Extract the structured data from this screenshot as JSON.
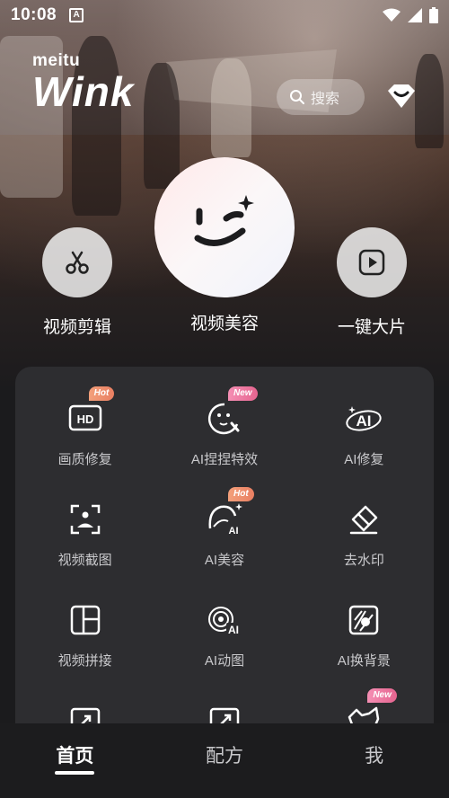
{
  "status_bar": {
    "time": "10:08",
    "notification_glyph": "A",
    "icons": [
      "wifi-icon",
      "cell-signal-icon",
      "battery-icon"
    ]
  },
  "header": {
    "brand": "meitu",
    "app_name": "Wink",
    "search_placeholder": "搜索",
    "vip_icon": "vip-diamond-icon"
  },
  "main_actions": [
    {
      "label": "视频剪辑",
      "icon": "scissors-icon"
    },
    {
      "label": "视频美容",
      "icon": "wink-face-icon"
    },
    {
      "label": "一键大片",
      "icon": "play-icon"
    }
  ],
  "tools": [
    {
      "label": "画质修复",
      "icon": "hd-icon",
      "badge": "Hot"
    },
    {
      "label": "AI捏捏特效",
      "icon": "squish-face-icon",
      "badge": "New"
    },
    {
      "label": "AI修复",
      "icon": "ai-repair-icon",
      "badge": ""
    },
    {
      "label": "视频截图",
      "icon": "screenshot-icon",
      "badge": ""
    },
    {
      "label": "AI美容",
      "icon": "ai-beauty-icon",
      "badge": "Hot"
    },
    {
      "label": "去水印",
      "icon": "eraser-icon",
      "badge": ""
    },
    {
      "label": "视频拼接",
      "icon": "collage-icon",
      "badge": ""
    },
    {
      "label": "AI动图",
      "icon": "ai-motion-icon",
      "badge": ""
    },
    {
      "label": "AI换背景",
      "icon": "ai-background-icon",
      "badge": ""
    },
    {
      "label": "",
      "icon": "expand-icon",
      "badge": ""
    },
    {
      "label": "",
      "icon": "ai-expand-icon",
      "badge": ""
    },
    {
      "label": "",
      "icon": "pet-icon",
      "badge": "New"
    }
  ],
  "bottom_nav": [
    {
      "label": "首页",
      "active": true
    },
    {
      "label": "配方",
      "active": false
    },
    {
      "label": "我",
      "active": false
    }
  ],
  "colors": {
    "background": "#1b1b1d",
    "panel": "#2d2d30",
    "badge_hot": "#ea8564",
    "badge_new": "#ea6e98"
  }
}
